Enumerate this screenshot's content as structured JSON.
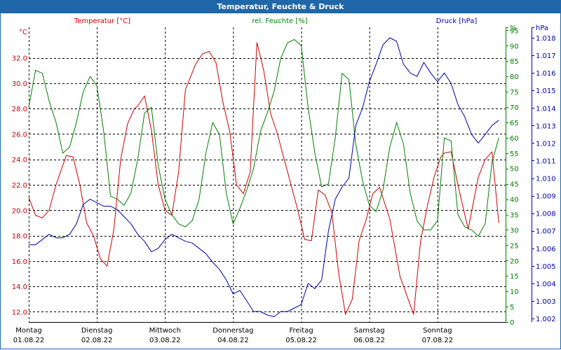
{
  "window": {
    "title": "Temperatur, Feuchte & Druck"
  },
  "colors": {
    "temperature": "#cc0000",
    "humidity": "#008000",
    "pressure": "#0000aa",
    "grid": "#000000",
    "title_bar": "#1f67a8"
  },
  "chart_data": {
    "type": "line",
    "grid": true,
    "x_range": [
      0,
      7
    ],
    "x_ticks": [
      {
        "x": 0,
        "day": "Montag",
        "date": "01.08.22"
      },
      {
        "x": 1,
        "day": "Dienstag",
        "date": "02.08.22"
      },
      {
        "x": 2,
        "day": "Mittwoch",
        "date": "03.08.22"
      },
      {
        "x": 3,
        "day": "Donnerstag",
        "date": "04.08.22"
      },
      {
        "x": 4,
        "day": "Freitag",
        "date": "05.08.22"
      },
      {
        "x": 5,
        "day": "Samstag",
        "date": "06.08.22"
      },
      {
        "x": 6,
        "day": "Sonntag",
        "date": "07.08.22"
      }
    ],
    "axes": {
      "temperature": {
        "unit": "°C",
        "min": 11.2,
        "max": 34.4,
        "ticks": [
          "12.0",
          "14.0",
          "16.0",
          "18.0",
          "20.0",
          "22.0",
          "24.0",
          "26.0",
          "28.0",
          "30.0",
          "32.0"
        ],
        "tick_values": [
          12,
          14,
          16,
          18,
          20,
          22,
          24,
          26,
          28,
          30,
          32
        ]
      },
      "humidity": {
        "unit": "%",
        "min": 0,
        "max": 96,
        "ticks": [
          "0",
          "5",
          "10",
          "15",
          "20",
          "25",
          "30",
          "35",
          "40",
          "45",
          "50",
          "55",
          "60",
          "65",
          "70",
          "75",
          "80",
          "85",
          "90",
          "95",
          "%"
        ],
        "tick_values": [
          0,
          5,
          10,
          15,
          20,
          25,
          30,
          35,
          40,
          45,
          50,
          55,
          60,
          65,
          70,
          75,
          80,
          85,
          90,
          95,
          96
        ]
      },
      "pressure": {
        "unit": "hPa",
        "min": 1.0018,
        "max": 1.0186,
        "ticks": [
          "1.002",
          "1.003",
          "1.004",
          "1.005",
          "1.006",
          "1.007",
          "1.008",
          "1.009",
          "1.010",
          "1.011",
          "1.012",
          "1.013",
          "1.014",
          "1.015",
          "1.016",
          "1.017",
          "1.018",
          "hPa"
        ],
        "tick_values": [
          1.002,
          1.003,
          1.004,
          1.005,
          1.006,
          1.007,
          1.008,
          1.009,
          1.01,
          1.011,
          1.012,
          1.013,
          1.014,
          1.015,
          1.016,
          1.017,
          1.018,
          1.0186
        ]
      }
    },
    "series": [
      {
        "key": "temperature",
        "name": "Temperatur [°C]",
        "x": [
          0,
          0.1,
          0.2,
          0.3,
          0.4,
          0.55,
          0.65,
          0.75,
          0.85,
          0.95,
          1.05,
          1.15,
          1.25,
          1.35,
          1.45,
          1.55,
          1.6,
          1.7,
          1.8,
          1.9,
          2.0,
          2.1,
          2.2,
          2.3,
          2.45,
          2.55,
          2.65,
          2.75,
          2.85,
          2.95,
          3.05,
          3.15,
          3.25,
          3.35,
          3.45,
          3.55,
          3.65,
          3.75,
          3.85,
          3.95,
          4.05,
          4.15,
          4.25,
          4.35,
          4.45,
          4.55,
          4.65,
          4.75,
          4.85,
          4.95,
          5.05,
          5.15,
          5.3,
          5.45,
          5.55,
          5.65,
          5.75,
          5.85,
          5.95,
          6.05,
          6.1,
          6.2,
          6.3,
          6.45,
          6.6,
          6.7,
          6.8,
          6.9
        ],
        "y": [
          21.0,
          19.6,
          19.4,
          20.0,
          22.0,
          24.3,
          24.2,
          22.0,
          19.0,
          18.0,
          16.2,
          15.6,
          18.5,
          24.0,
          26.8,
          28.0,
          28.2,
          29.0,
          26.3,
          22.0,
          20.0,
          19.6,
          23.0,
          29.5,
          31.5,
          32.3,
          32.5,
          31.6,
          28.5,
          26.2,
          22.0,
          21.3,
          23.0,
          33.2,
          31.0,
          27.6,
          26.0,
          24.0,
          22.0,
          20.0,
          17.7,
          17.6,
          21.6,
          21.2,
          19.8,
          15.0,
          11.8,
          13.0,
          17.6,
          19.2,
          21.3,
          21.8,
          19.3,
          14.8,
          13.3,
          11.8,
          17.5,
          20.3,
          22.6,
          24.2,
          24.5,
          24.6,
          22.0,
          18.5,
          22.6,
          24.0,
          24.6,
          19.0
        ]
      },
      {
        "key": "humidity",
        "name": "rel. Feuchte [%]",
        "x": [
          0,
          0.1,
          0.2,
          0.3,
          0.4,
          0.5,
          0.6,
          0.7,
          0.8,
          0.9,
          1.0,
          1.1,
          1.2,
          1.3,
          1.4,
          1.5,
          1.6,
          1.7,
          1.8,
          1.9,
          2.0,
          2.1,
          2.2,
          2.3,
          2.4,
          2.5,
          2.6,
          2.7,
          2.8,
          2.9,
          3.0,
          3.1,
          3.2,
          3.3,
          3.4,
          3.5,
          3.6,
          3.7,
          3.8,
          3.9,
          4.0,
          4.1,
          4.2,
          4.3,
          4.4,
          4.5,
          4.6,
          4.7,
          4.8,
          4.9,
          5.0,
          5.1,
          5.2,
          5.3,
          5.4,
          5.5,
          5.6,
          5.7,
          5.8,
          5.9,
          6.0,
          6.1,
          6.2,
          6.3,
          6.4,
          6.5,
          6.6,
          6.7,
          6.8,
          6.9
        ],
        "y": [
          70,
          82,
          81,
          72,
          65,
          55,
          57,
          65,
          75,
          80,
          77,
          62,
          41,
          40,
          38,
          42,
          53,
          68,
          70,
          51,
          40,
          35,
          32,
          31,
          33,
          40,
          55,
          65,
          61,
          42,
          32,
          37,
          43,
          50,
          62,
          68,
          75,
          86,
          91,
          92,
          90,
          70,
          55,
          44,
          45,
          60,
          81,
          79,
          58,
          46,
          38,
          36,
          43,
          57,
          65,
          58,
          42,
          33,
          30,
          30,
          33,
          60,
          59,
          35,
          31,
          30,
          28,
          32,
          52,
          60
        ]
      },
      {
        "key": "pressure",
        "name": "Druck [hPa]",
        "x": [
          0,
          0.1,
          0.2,
          0.3,
          0.4,
          0.5,
          0.6,
          0.7,
          0.8,
          0.9,
          1.0,
          1.1,
          1.2,
          1.3,
          1.4,
          1.5,
          1.6,
          1.7,
          1.8,
          1.9,
          2.0,
          2.1,
          2.2,
          2.3,
          2.4,
          2.5,
          2.6,
          2.7,
          2.8,
          2.9,
          3.0,
          3.1,
          3.2,
          3.3,
          3.4,
          3.5,
          3.6,
          3.7,
          3.8,
          3.9,
          4.0,
          4.1,
          4.2,
          4.3,
          4.4,
          4.5,
          4.6,
          4.7,
          4.8,
          4.9,
          5.0,
          5.1,
          5.2,
          5.3,
          5.4,
          5.5,
          5.6,
          5.7,
          5.8,
          5.9,
          6.0,
          6.1,
          6.2,
          6.3,
          6.4,
          6.5,
          6.6,
          6.7,
          6.8,
          6.9
        ],
        "y": [
          1.0062,
          1.0062,
          1.0065,
          1.0068,
          1.0066,
          1.0066,
          1.0068,
          1.0074,
          1.0085,
          1.0088,
          1.0086,
          1.0084,
          1.0084,
          1.0082,
          1.0078,
          1.0074,
          1.0068,
          1.0064,
          1.0058,
          1.006,
          1.0065,
          1.0068,
          1.0066,
          1.0064,
          1.0063,
          1.006,
          1.0057,
          1.0052,
          1.0048,
          1.0042,
          1.0034,
          1.0036,
          1.003,
          1.0024,
          1.0024,
          1.0022,
          1.0021,
          1.0024,
          1.0024,
          1.0026,
          1.0028,
          1.004,
          1.0037,
          1.0042,
          1.007,
          1.0088,
          1.0095,
          1.01,
          1.013,
          1.014,
          1.0155,
          1.0165,
          1.0176,
          1.018,
          1.0178,
          1.0165,
          1.016,
          1.0158,
          1.0166,
          1.016,
          1.0155,
          1.016,
          1.0154,
          1.0142,
          1.0135,
          1.0125,
          1.012,
          1.0125,
          1.013,
          1.0133
        ]
      }
    ]
  }
}
